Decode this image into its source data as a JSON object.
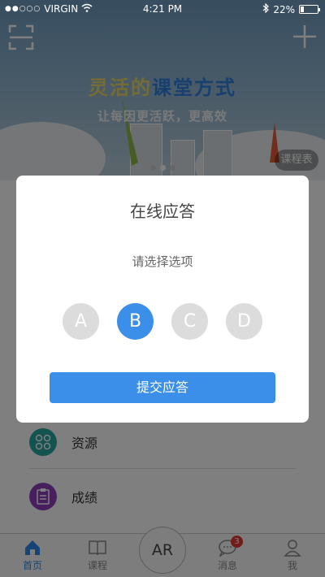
{
  "status_bar": {
    "carrier": "VIRGIN",
    "time": "4:21 PM",
    "battery": "22%",
    "battery_level": 0.22
  },
  "banner": {
    "title_part1": "灵活的",
    "title_part2": "课堂方式",
    "subtitle": "让每因更活跃，更高效",
    "schedule_button": "课程表",
    "slide_count": 3,
    "active_slide": 2
  },
  "list": {
    "items": [
      {
        "label": "资源",
        "icon": "resources-icon",
        "color": "#2aa7a1"
      },
      {
        "label": "成绩",
        "icon": "grades-icon",
        "color": "#8e3fbf"
      }
    ]
  },
  "tabbar": {
    "tabs": [
      {
        "label": "首页",
        "icon": "home-icon",
        "active": true
      },
      {
        "label": "课程",
        "icon": "book-icon",
        "active": false
      },
      {
        "label": "消息",
        "icon": "message-icon",
        "active": false,
        "badge": "3"
      },
      {
        "label": "我",
        "icon": "person-icon",
        "active": false
      }
    ],
    "center_label": "AR"
  },
  "dialog": {
    "title": "在线应答",
    "prompt": "请选择选项",
    "options": [
      "A",
      "B",
      "C",
      "D"
    ],
    "selected": "B",
    "submit_label": "提交应答"
  },
  "colors": {
    "accent": "#3c8fe8",
    "active_tab": "#2e88e8",
    "badge": "#e53935"
  }
}
